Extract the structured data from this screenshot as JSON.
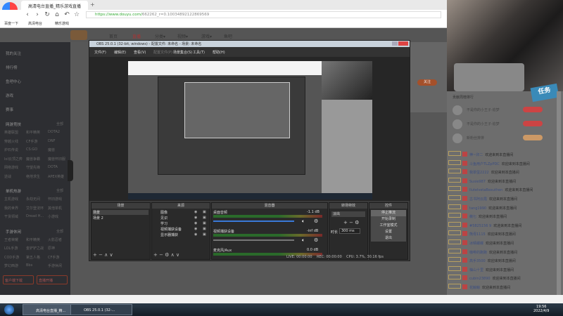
{
  "browser": {
    "tab_title": "高清电台直播_精乐游戏直播",
    "logo_label": "没有登录",
    "url_host": "https://www.douyu.com/",
    "url_path": "662262_r=0.10034892122869569",
    "bookmarks": [
      "百度一下",
      "高清电台",
      "精乐游戏"
    ]
  },
  "douyu": {
    "nav": [
      "首页",
      "直播",
      "分类▾",
      "视频▾",
      "游戏▾",
      "鱼吧"
    ],
    "follow_label": "关注",
    "sidebar": {
      "top": [
        "我的关注",
        "排行榜",
        "鱼吧中心",
        "游戏",
        "赛事"
      ],
      "sections": [
        {
          "title": "网游竞技",
          "more": "全部",
          "items": [
            "英雄联盟",
            "和平精英",
            "DOTA2",
            "穿越火线",
            "CF手游",
            "DNF",
            "炉石传说",
            "CS:GO",
            "魔兽",
            "lol云顶之弈",
            "魔兽争霸",
            "魔兽怀旧服",
            "网络游戏",
            "守望先锋",
            "DOTA",
            "逆战",
            "绝地求生",
            "APEX英雄"
          ]
        },
        {
          "title": "单机热游",
          "more": "全部",
          "items": [
            "主机游戏",
            "永劫无间",
            "怀旧游戏",
            "我的世界",
            "艾尔登法环",
            "其他单机",
            "干货领域",
            "Dread H...",
            "小游戏"
          ]
        },
        {
          "title": "手游休闲",
          "more": "全部",
          "items": [
            "王者荣耀",
            "和平精英",
            "火影忍者",
            "LOL手游",
            "金铲铲之战",
            "原神",
            "COD手游",
            "第五人格",
            "CF手游",
            "梦幻西游",
            "Bbs",
            "手游休闲"
          ]
        }
      ],
      "buttons": [
        "客户端下载",
        "直播开播"
      ]
    }
  },
  "chat": {
    "rank_title": "贡献周榜排行",
    "rank": [
      "不是你的小王子·追梦",
      "不是你的小王子·追梦",
      "新粉丝排排"
    ],
    "badge": "任务",
    "welcome": "欢迎来到本直播间",
    "messages": [
      {
        "level": "LV27",
        "name": "神~卯二"
      },
      {
        "level": "LV16",
        "name": "斗鱼用户TLZpPDC"
      },
      {
        "level": "LV18",
        "name": "我翠蛋2222"
      },
      {
        "level": "LV23",
        "name": "Susie987"
      },
      {
        "level": "LV16",
        "name": "llutelvetaBexuthen"
      },
      {
        "level": "LV31",
        "name": "古书阿云霞"
      },
      {
        "level": "LV15",
        "name": "tang1990"
      },
      {
        "level": "LV17",
        "name": "薇七"
      },
      {
        "level": "LV8",
        "name": "#5825156 9"
      },
      {
        "level": "LV10",
        "name": "熊母1115"
      },
      {
        "level": "LV12",
        "name": "冰晴蝶蝶"
      },
      {
        "level": "LV22",
        "name": "咖啡的跑跑"
      },
      {
        "level": "LV16",
        "name": "高手3500"
      },
      {
        "level": "LV20",
        "name": "柚山十里"
      },
      {
        "level": "LV14",
        "name": "cubin23890"
      },
      {
        "level": "LV18",
        "name": "花鲸鲸"
      }
    ]
  },
  "obs": {
    "title": "OBS 25.0.1 (32-bit, windows) - 配置文件: 未命名 - 场景: 未命名",
    "menu": [
      "文件(F)",
      "编辑(E)",
      "查看(V)",
      "配置文件(P)",
      "场景集合(S)",
      "工具(T)",
      "帮助(H)"
    ],
    "docks": {
      "scenes": "场景",
      "sources": "来源",
      "mixer": "混音器",
      "transitions": "转场特效",
      "controls": "控件"
    },
    "scenes": [
      "场景",
      "场景 2"
    ],
    "sources": [
      "图像",
      "见识",
      "学习",
      "视频捕获设备",
      "显示器捕获"
    ],
    "mixer": [
      {
        "name": "桌面音频",
        "db": "-1.1 dB"
      },
      {
        "name": "视频捕获设备",
        "db": "-inf dB"
      },
      {
        "name": "麦克风/Aux",
        "db": "0.0 dB"
      }
    ],
    "transition": {
      "type": "淡出",
      "duration_label": "时长",
      "duration": "300 ms"
    },
    "controls": [
      "停止推流",
      "开始录制",
      "工作室模式",
      "设置",
      "退出"
    ],
    "status": {
      "live": "LIVE: 00:00:00",
      "rec": "REC: 00:00:00",
      "cpu": "CPU: 3.7%, 30.16 fps"
    }
  },
  "taskbar": {
    "items": [
      "高清电台直播_精...",
      "OBS 25.0.1 (32-..."
    ],
    "time": "19:56",
    "date": "2022/4/9"
  }
}
